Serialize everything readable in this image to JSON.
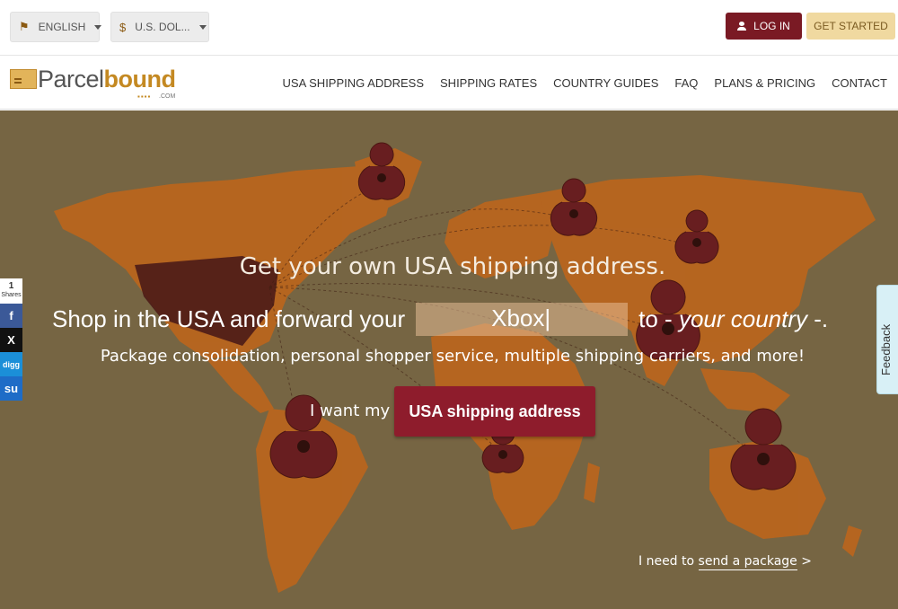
{
  "topbar": {
    "language_label": "ENGLISH",
    "language_icon": "flag-icon",
    "currency_label": "U.S. DOL...",
    "currency_icon": "dollar-icon",
    "currency_symbol": "$",
    "login_label": "LOG IN",
    "get_started_label": "GET STARTED"
  },
  "logo": {
    "part1": "Parcel",
    "part2": "bound",
    "suffix": ".COM",
    "dots": "▪▪▪▪"
  },
  "nav": {
    "items": [
      "USA SHIPPING ADDRESS",
      "SHIPPING RATES",
      "COUNTRY GUIDES",
      "FAQ",
      "PLANS & PRICING",
      "CONTACT"
    ]
  },
  "hero": {
    "subtitle": "Get your own USA shipping address.",
    "main_prefix": "Shop in the USA and forward your",
    "typed_word": "Xbox",
    "main_to": "to -",
    "main_country": "your country",
    "main_suffix": "-.",
    "description": "Package consolidation, personal shopper service, multiple shipping carriers, and more!",
    "want_label": "I want my",
    "cta_label": "USA shipping address",
    "send_prefix": "I need to",
    "send_link": "send a package",
    "send_arrow": ">"
  },
  "share": {
    "count": "1",
    "count_label": "Shares",
    "buttons": [
      {
        "name": "facebook-icon",
        "glyph": "f"
      },
      {
        "name": "x-icon",
        "glyph": "X"
      },
      {
        "name": "digg-icon",
        "glyph": "digg"
      },
      {
        "name": "stumbleupon-icon",
        "glyph": "su"
      }
    ]
  },
  "feedback": {
    "label": "Feedback"
  },
  "colors": {
    "brand_maroon": "#7a1a24",
    "brand_gold": "#c48922",
    "cta_red": "#8e1c2c",
    "get_started_bg": "#f0d9a0",
    "map_orange": "#c66a1e",
    "hero_bg": "#7a6a48"
  }
}
